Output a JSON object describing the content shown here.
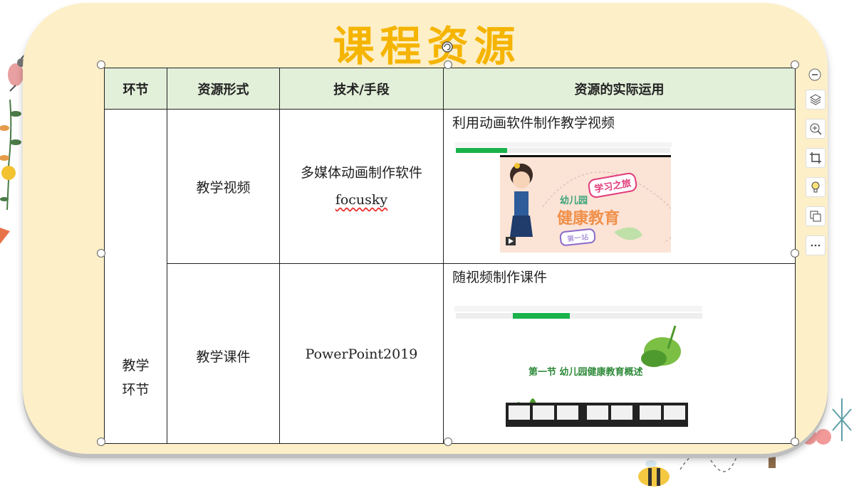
{
  "title": "课程资源",
  "table": {
    "headers": [
      "环节",
      "资源形式",
      "技术/手段",
      "资源的实际运用"
    ],
    "stage": "教学\n环节",
    "rows": [
      {
        "form": "教学视频",
        "tool_line1": "多媒体动画制作软件",
        "tool_line2": "focusky",
        "usage": "利用动画软件制作教学视频"
      },
      {
        "form": "教学课件",
        "tool_line1": "PowerPoint2019",
        "usage": "随视频制作课件"
      }
    ]
  },
  "thumb1": {
    "badge": "学习之旅",
    "subtitle": "幼儿园",
    "heading": "健康教育",
    "tag": "第一站"
  },
  "thumb2": {
    "heading": "第一节 幼儿园健康教育概述"
  },
  "colors": {
    "title": "#f5b400",
    "header_bg": "#e2efd9",
    "card_bg": "#fdefc8"
  },
  "toolbar_icons": [
    "minus-circle-icon",
    "layers-icon",
    "zoom-in-icon",
    "crop-icon",
    "lightbulb-icon",
    "copy-icon",
    "more-icon"
  ]
}
